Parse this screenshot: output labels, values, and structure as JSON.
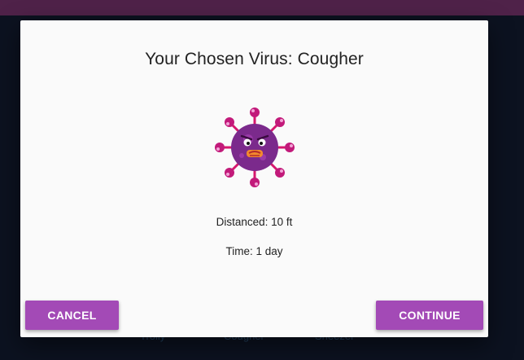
{
  "background": {
    "items": [
      "Trolly",
      "Cougher",
      "Sneezer"
    ]
  },
  "dialog": {
    "title": "Your Chosen Virus: Cougher",
    "stats": {
      "distanced": "Distanced: 10 ft",
      "time": "Time: 1 day"
    },
    "buttons": {
      "cancel": "CANCEL",
      "continue": "CONTINUE"
    }
  },
  "colors": {
    "accent": "#a34ab6",
    "topbar": "#4f2249",
    "virus_body": "#7b2a8c",
    "virus_spikes": "#d6186e"
  },
  "icons": {
    "virus": "virus-character-icon"
  }
}
